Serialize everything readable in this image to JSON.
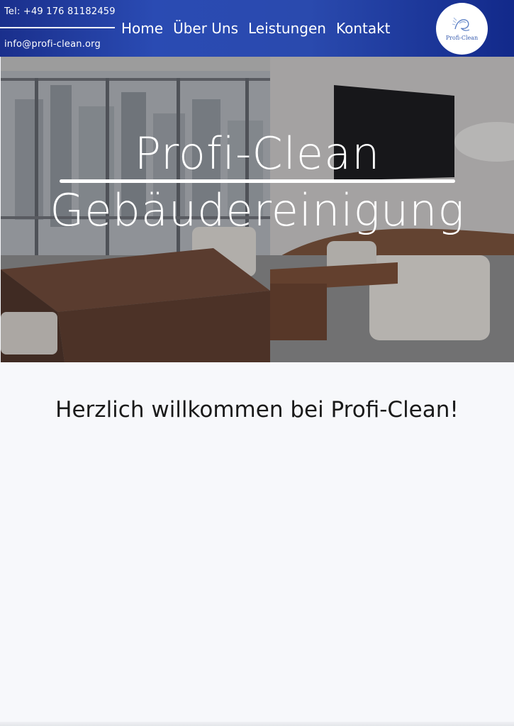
{
  "header": {
    "phone": "Tel: +49 176 81182459",
    "email": "info@profi-clean.org",
    "nav": [
      "Home",
      "Über Uns",
      "Leistungen",
      "Kontakt"
    ],
    "logo_text": "Profi-Clean",
    "colors": {
      "header_start": "#1a2f8c",
      "header_end": "#12298a"
    }
  },
  "hero": {
    "title_line1": "Profi-Clean",
    "title_line2": "Gebäudereinigung"
  },
  "main": {
    "welcome": "Herzlich willkommen bei Profi-Clean!"
  }
}
